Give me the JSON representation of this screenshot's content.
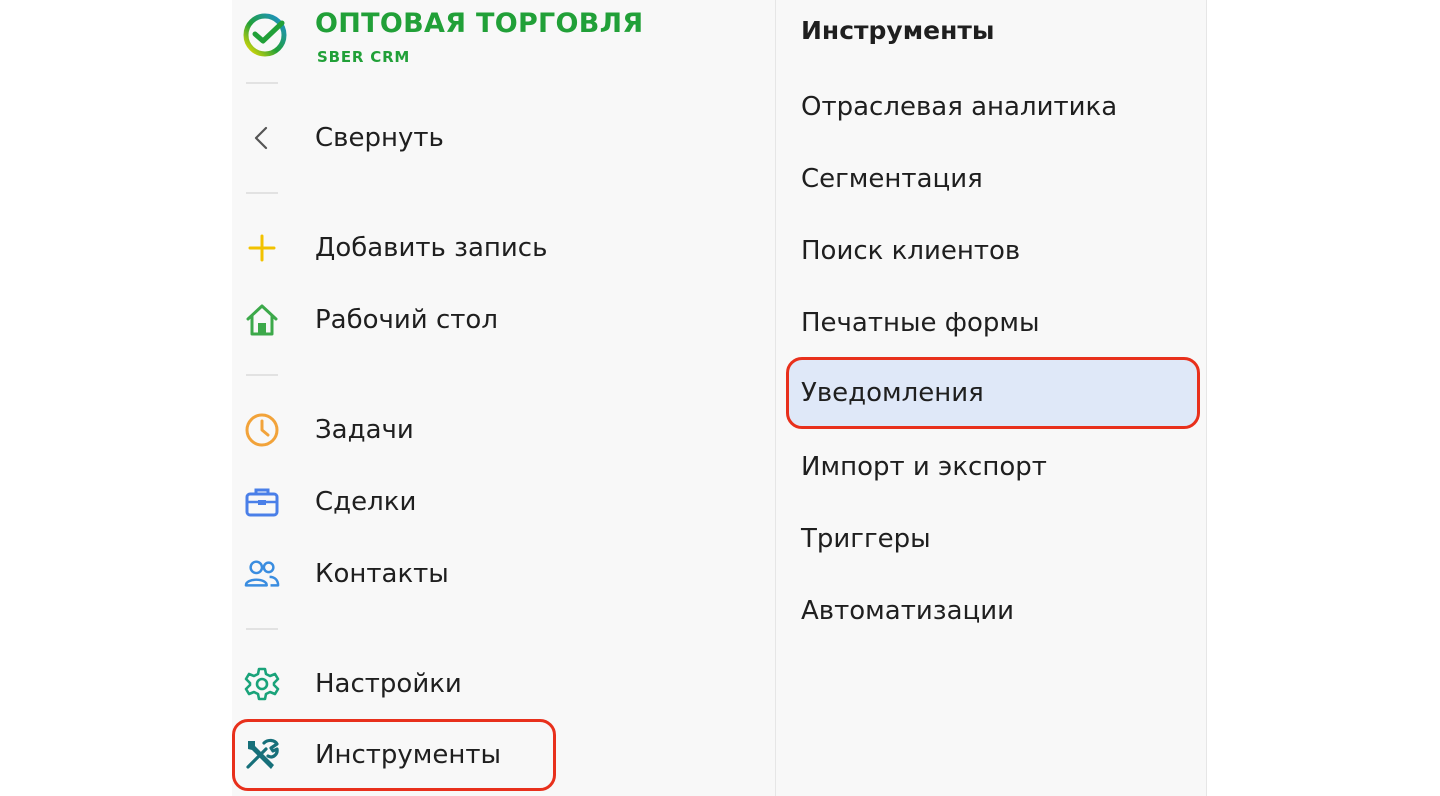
{
  "brand": {
    "title": "ОПТОВАЯ ТОРГОВЛЯ",
    "subtitle": "SBER CRM",
    "color": "#21a038"
  },
  "sidebar": {
    "items": [
      {
        "label": "Свернуть",
        "icon": "chevron-left-icon"
      },
      {
        "label": "Добавить запись",
        "icon": "plus-icon",
        "color": "#f2c200"
      },
      {
        "label": "Рабочий стол",
        "icon": "home-icon",
        "color": "#3ca94a"
      },
      {
        "label": "Задачи",
        "icon": "clock-icon",
        "color": "#f2a33a"
      },
      {
        "label": "Сделки",
        "icon": "briefcase-icon",
        "color": "#4a7fe8"
      },
      {
        "label": "Контакты",
        "icon": "contacts-icon",
        "color": "#3a8de0"
      },
      {
        "label": "Настройки",
        "icon": "gear-icon",
        "color": "#1aa37a"
      },
      {
        "label": "Инструменты",
        "icon": "tools-icon",
        "color": "#17707a",
        "highlighted": true
      }
    ]
  },
  "tools_menu": {
    "title": "Инструменты",
    "items": [
      {
        "label": "Отраслевая аналитика"
      },
      {
        "label": "Сегментация"
      },
      {
        "label": "Поиск клиентов"
      },
      {
        "label": "Печатные формы"
      },
      {
        "label": "Уведомления",
        "active": true
      },
      {
        "label": "Импорт и экспорт"
      },
      {
        "label": "Триггеры"
      },
      {
        "label": "Автоматизации"
      }
    ]
  },
  "colors": {
    "highlight_border": "#e8301c",
    "active_bg": "#dfe8f8"
  }
}
